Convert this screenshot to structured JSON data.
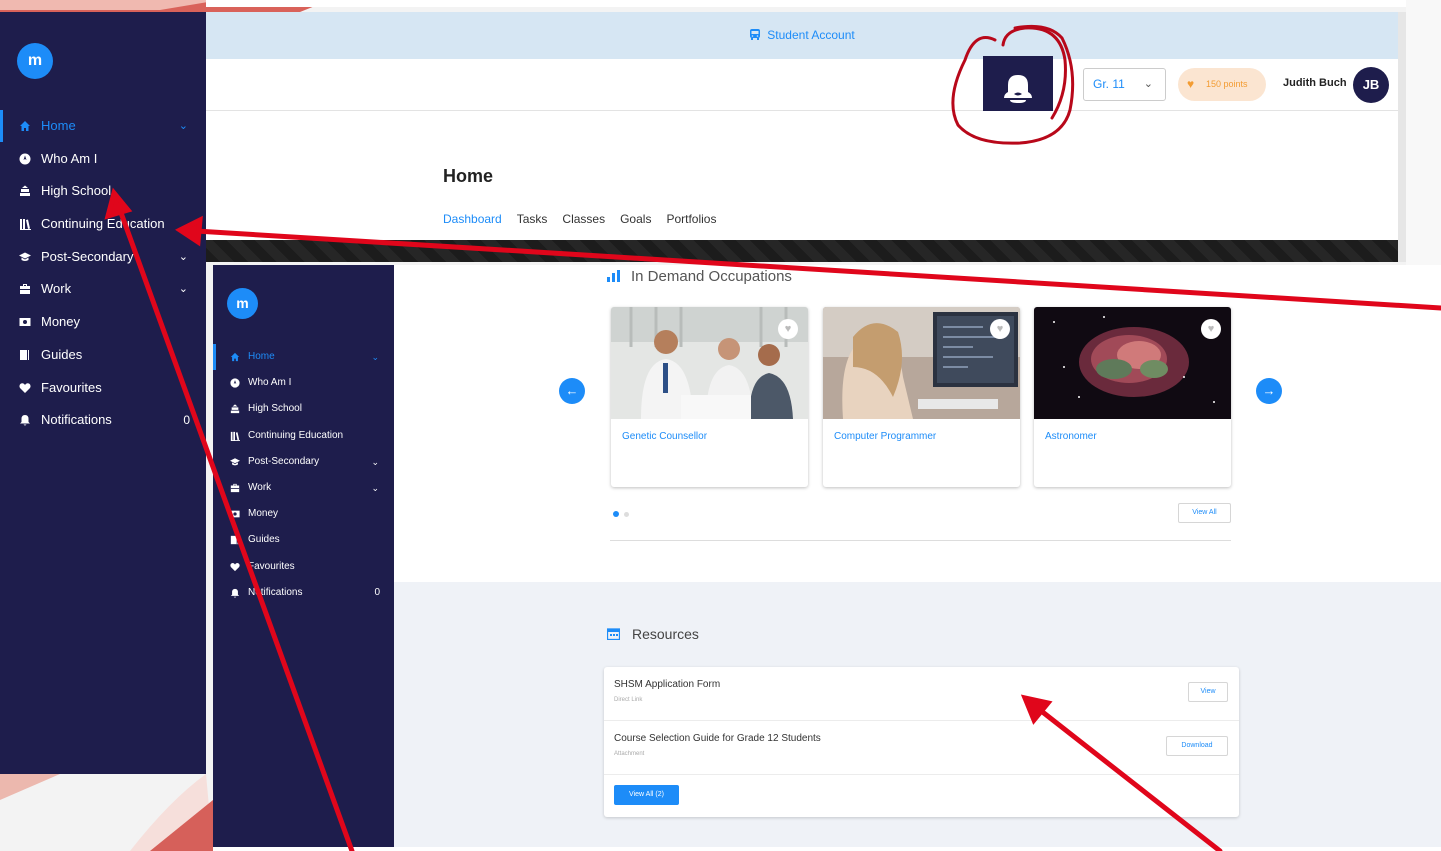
{
  "colors": {
    "sidebar": "#1e1d4c",
    "accent": "#1d8cf8",
    "annotation": "#e0061b"
  },
  "top": {
    "banner": {
      "icon": "bus-icon",
      "text": "Student Account"
    },
    "grade_select": {
      "value": "Gr. 11"
    },
    "points": {
      "text": "150 points",
      "icon": "heart-icon"
    },
    "user": {
      "name": "Judith Buch",
      "initials": "JB"
    },
    "page_title": "Home",
    "tabs": [
      "Dashboard",
      "Tasks",
      "Classes",
      "Goals",
      "Portfolios"
    ],
    "logo": "m",
    "nav": [
      {
        "label": "Home",
        "icon": "home-icon",
        "active": true,
        "chevron": true
      },
      {
        "label": "Who Am I",
        "icon": "compass-icon"
      },
      {
        "label": "High School",
        "icon": "school-icon"
      },
      {
        "label": "Continuing Education",
        "icon": "books-icon"
      },
      {
        "label": "Post-Secondary",
        "icon": "graduation-cap-icon",
        "chevron": true
      },
      {
        "label": "Work",
        "icon": "briefcase-icon",
        "chevron": true
      },
      {
        "label": "Money",
        "icon": "money-icon"
      },
      {
        "label": "Guides",
        "icon": "book-icon"
      },
      {
        "label": "Favourites",
        "icon": "heart-icon"
      },
      {
        "label": "Notifications",
        "icon": "bell-icon",
        "count": "0"
      }
    ]
  },
  "bottom": {
    "logo": "m",
    "nav": [
      {
        "label": "Home"
      },
      {
        "label": "Who Am I"
      },
      {
        "label": "High School"
      },
      {
        "label": "Continuing Education"
      },
      {
        "label": "Post-Secondary"
      },
      {
        "label": "Work"
      },
      {
        "label": "Money"
      },
      {
        "label": "Guides"
      },
      {
        "label": "Favourites"
      },
      {
        "label": "Notifications",
        "count": "0"
      }
    ],
    "occupations": {
      "title": "In Demand Occupations",
      "cards": [
        "Genetic Counsellor",
        "Computer Programmer",
        "Astronomer"
      ],
      "view_all": "View All"
    },
    "resources": {
      "title": "Resources",
      "items": [
        {
          "name": "SHSM Application Form",
          "type": "Direct Link",
          "action": "View"
        },
        {
          "name": "Course Selection Guide for Grade 12 Students",
          "type": "Attachment",
          "action": "Download"
        }
      ],
      "view_all": "View All (2)"
    }
  }
}
